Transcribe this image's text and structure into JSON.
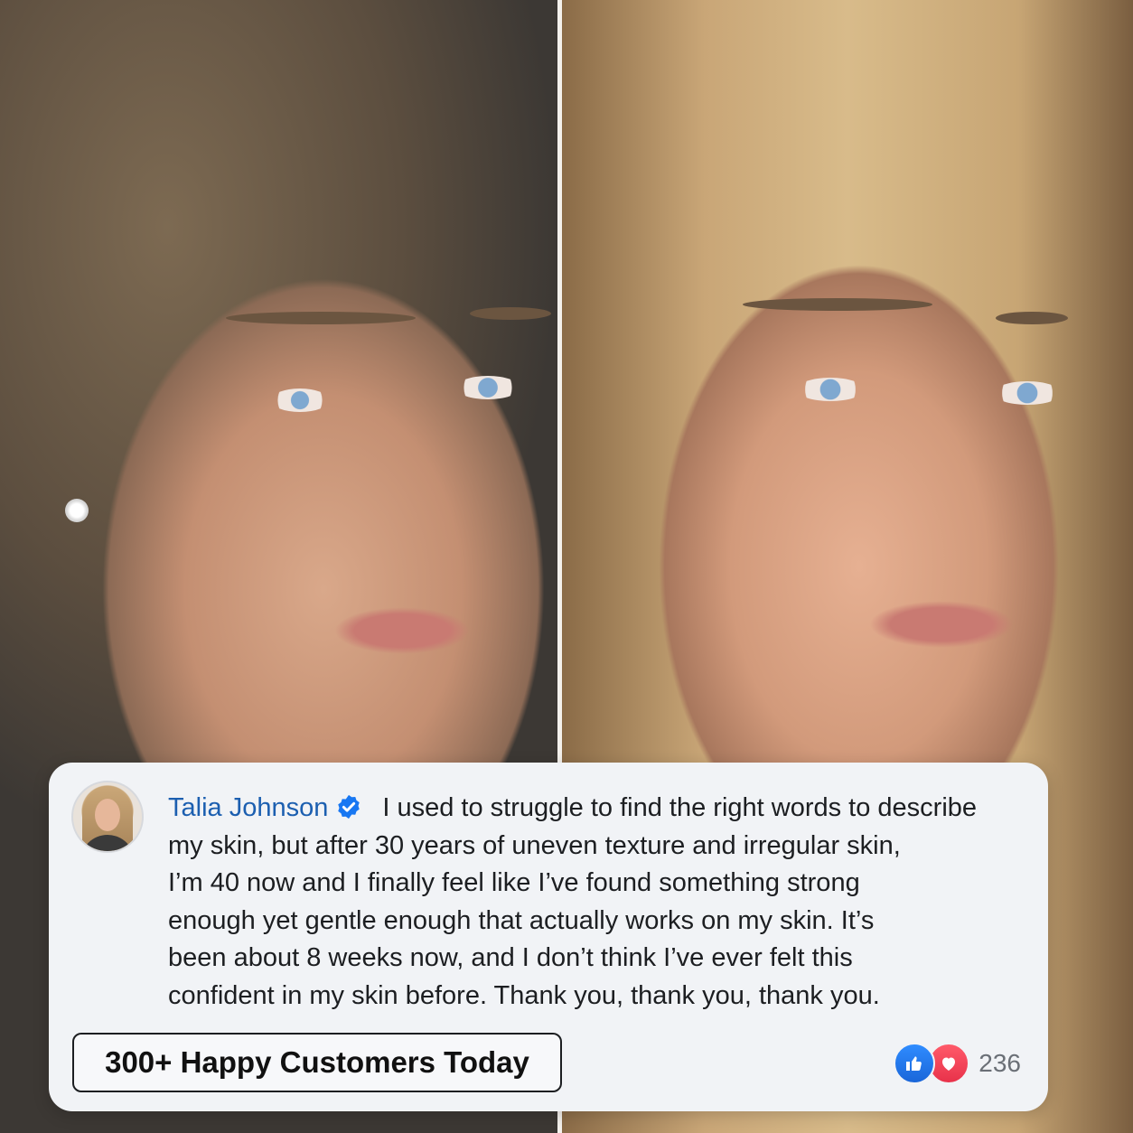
{
  "review": {
    "author": "Talia Johnson",
    "text_lines": [
      "I used to struggle to find the right words to describe",
      "my skin, but after 30 years of uneven texture and irregular skin,",
      "I’m 40 now and I finally feel like I’ve found something strong",
      "enough yet gentle enough that actually works on my skin. It’s",
      "been about 8 weeks now, and I don’t think I’ve ever felt this",
      "confident in my skin before. Thank you, thank you, thank you."
    ],
    "reaction_count": "236"
  },
  "cta": {
    "label": "300+ Happy Customers Today"
  },
  "icons": {
    "verified": "verified-badge-icon",
    "like": "thumbs-up-icon",
    "love": "heart-icon"
  },
  "colors": {
    "author_name": "#1c5fb0",
    "verified_badge": "#1877f2",
    "like": "#1a73e8",
    "love": "#f0384f",
    "card_bg": "#f1f3f6"
  }
}
